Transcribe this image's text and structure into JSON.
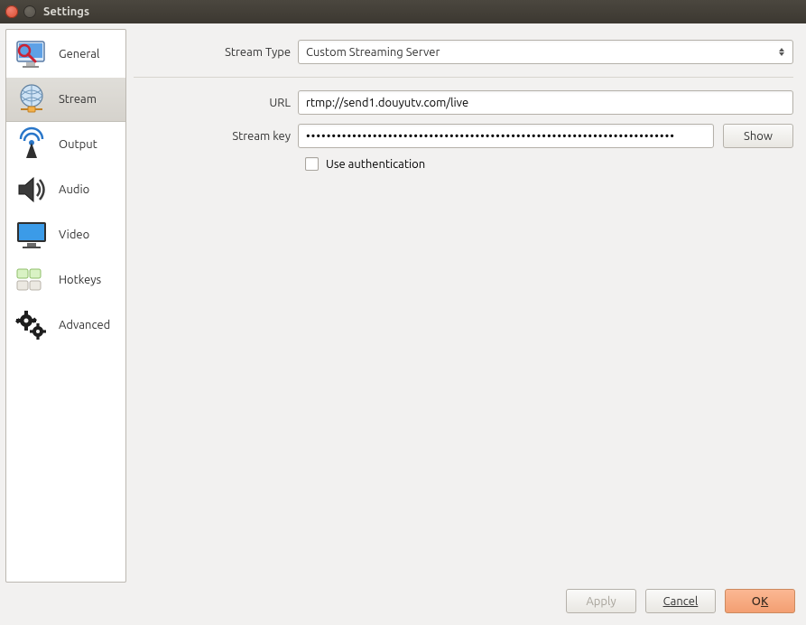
{
  "window": {
    "title": "Settings"
  },
  "sidebar": {
    "items": [
      {
        "label": "General"
      },
      {
        "label": "Stream"
      },
      {
        "label": "Output"
      },
      {
        "label": "Audio"
      },
      {
        "label": "Video"
      },
      {
        "label": "Hotkeys"
      },
      {
        "label": "Advanced"
      }
    ]
  },
  "main": {
    "stream_type_label": "Stream Type",
    "stream_type_value": "Custom Streaming Server",
    "url_label": "URL",
    "url_value": "rtmp://send1.douyutv.com/live",
    "stream_key_label": "Stream key",
    "stream_key_value": "••••••••••••••••••••••••••••••••••••••••••••••••••••••••••••••••••••••••",
    "show_label": "Show",
    "use_auth_label": "Use authentication"
  },
  "footer": {
    "apply": "Apply",
    "cancel": "Cancel",
    "ok_prefix": "O",
    "ok_underline": "K"
  }
}
